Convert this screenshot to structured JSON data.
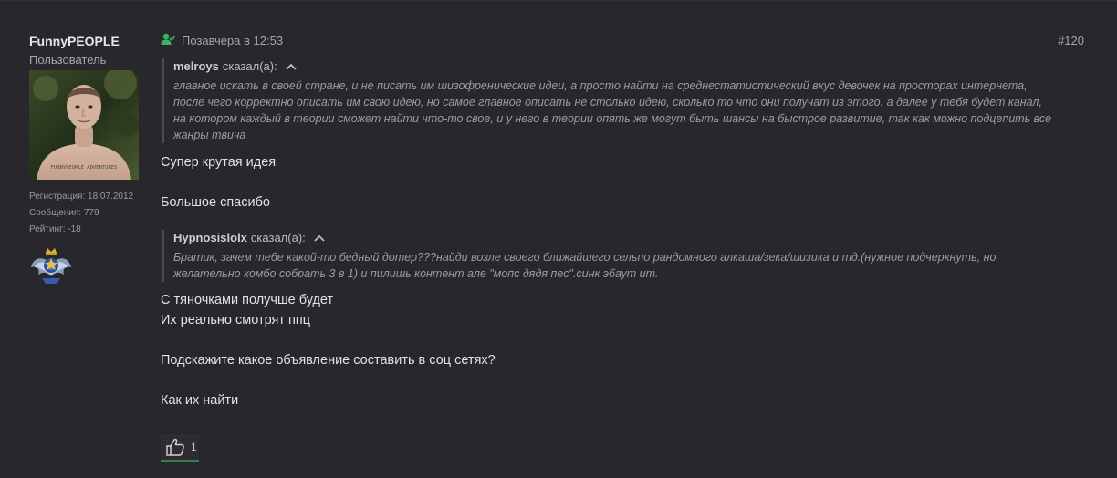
{
  "user": {
    "name": "FunnyPEOPLE",
    "title": "Пользователь",
    "registration": "Регистрация: 18.07.2012",
    "messages": "Сообщения: 779",
    "rating": "Рейтинг: -18",
    "avatar_tattoo_text": "FUNNYPEOPLE ADVENTURES"
  },
  "post": {
    "date": "Позавчера в 12:53",
    "number": "#120",
    "quote1": {
      "author": "melroys",
      "said": "сказал(а):",
      "lines": [
        "главное искать в своей стране, и не писать им шизофренические идеи, а просто найти на среднестатистический вкус девочек на просторах интернета,",
        "после чего корректно описать им свою идею, но самое главное описать не столько идею, сколько то что они получат из этого. а далее у тебя будет канал,",
        "на котором каждый в теории сможет найти что-то свое, и у него в теории опять же могут быть шансы на быстрое развитие, так как можно подцепить все",
        "жанры твича"
      ]
    },
    "reply1": [
      "Супер крутая идея",
      "",
      "Большое спасибо"
    ],
    "quote2": {
      "author": "Hypnosislolx",
      "said": "сказал(а):",
      "lines": [
        "Братик, зачем тебе какой-то бедный дотер???найди возле своего ближайшего сельпо рандомного алкаша/зека/шизика и тд.(нужное подчеркнуть, но",
        "желательно комбо собрать 3 в 1) и пилишь контент але \"мопс дядя пес\".синк эбаут ит."
      ]
    },
    "reply2": [
      "С тяночками получше будет",
      "Их реально смотрят ппц",
      "",
      "Подскажите какое объявление составить в соц сетях?",
      "",
      "Как их найти"
    ],
    "likes": "1"
  },
  "colors": {
    "background": "#28282c",
    "online_green": "#3fb06a",
    "like_underline": "#3a7a52"
  }
}
